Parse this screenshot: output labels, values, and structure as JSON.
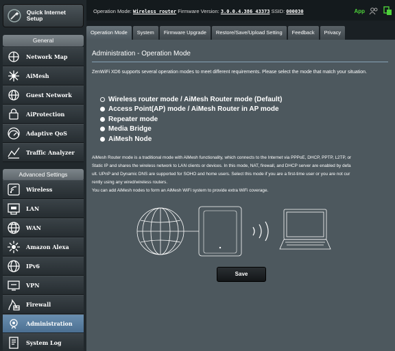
{
  "sidebar": {
    "quick_setup": "Quick Internet Setup",
    "general_label": "General",
    "general_items": [
      {
        "label": "Network Map",
        "icon": "network-map-icon"
      },
      {
        "label": "AiMesh",
        "icon": "aimesh-icon"
      },
      {
        "label": "Guest Network",
        "icon": "guest-network-icon"
      },
      {
        "label": "AiProtection",
        "icon": "lock-icon"
      },
      {
        "label": "Adaptive QoS",
        "icon": "gauge-icon"
      },
      {
        "label": "Traffic Analyzer",
        "icon": "traffic-analyzer-icon"
      }
    ],
    "advanced_label": "Advanced Settings",
    "advanced_items": [
      {
        "label": "Wireless",
        "icon": "wireless-icon"
      },
      {
        "label": "LAN",
        "icon": "lan-icon"
      },
      {
        "label": "WAN",
        "icon": "globe-icon"
      },
      {
        "label": "Amazon Alexa",
        "icon": "alexa-icon"
      },
      {
        "label": "IPv6",
        "icon": "ipv6-icon"
      },
      {
        "label": "VPN",
        "icon": "vpn-icon"
      },
      {
        "label": "Firewall",
        "icon": "firewall-icon"
      },
      {
        "label": "Administration",
        "icon": "administration-icon",
        "active": true
      },
      {
        "label": "System Log",
        "icon": "system-log-icon"
      }
    ]
  },
  "topbar": {
    "op_mode_label": "Operation Mode:",
    "op_mode_value": "Wireless router",
    "fw_label": "Firmware Version:",
    "fw_value": "3.0.0.4.386_43373",
    "ssid_label": "SSID:",
    "ssid_value": "000030",
    "app_label": "App"
  },
  "tabs": [
    "Operation Mode",
    "System",
    "Firmware Upgrade",
    "Restore/Save/Upload Setting",
    "Feedback",
    "Privacy"
  ],
  "content": {
    "title": "Administration - Operation Mode",
    "description": "ZenWiFi XD6 supports several operation modes to meet different requirements. Please select the mode that match your situation.",
    "modes": [
      "Wireless router mode / AiMesh Router mode (Default)",
      "Access Point(AP) mode / AiMesh Router in AP mode",
      "Repeater mode",
      "Media Bridge",
      "AiMesh Node"
    ],
    "mode_paragraph": [
      "AiMesh Router mode is a traditional mode with AiMesh functionality, which connects to the Internet via PPPoE, DHCP, PPTP, L2TP, or",
      "Static IP and shares the wireless network to LAN clients or devices. In this mode, NAT, firewall, and DHCP server are enabled by defa",
      "ult. UPnP and Dynamic DNS are supported for SOHO and home users. Select this mode if you are a first-time user or you are not cur",
      "rently using any wired/wireless routers.",
      "You can add AiMesh nodes to form an AiMesh WiFi system to provide extra WiFi coverage."
    ],
    "save_label": "Save"
  }
}
